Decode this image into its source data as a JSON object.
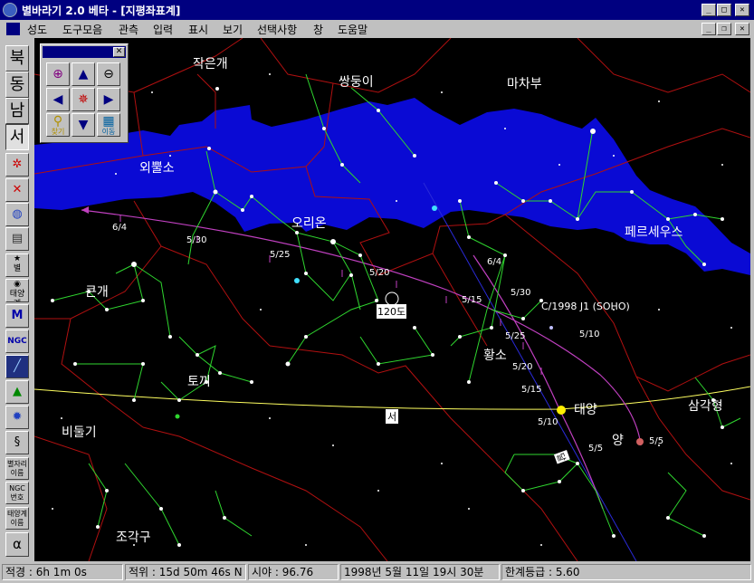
{
  "window": {
    "title": "별바라기 2.0 베타 - [지평좌표계]"
  },
  "menu": [
    "성도",
    "도구모음",
    "관측",
    "입력",
    "표시",
    "보기",
    "선택사항",
    "창",
    "도움말"
  ],
  "toolbar": {
    "directions": [
      "북",
      "동",
      "남",
      "서"
    ],
    "small_labels": [
      "별자리 이름",
      "NGC 번호",
      "태양계 이름"
    ],
    "greek": "α",
    "tools": [
      "ecliptic-grid-icon",
      "cross-icon",
      "globe-icon",
      "printer-icon",
      "star-chart-icon",
      "eye-icon",
      "messier-icon",
      "ngc-icon",
      "telescope-icon",
      "planet-icon",
      "sun-icon",
      "spiral-icon"
    ],
    "tool_labels": {
      "stars": "별",
      "solar": "태양계",
      "messier": "M",
      "ngc": "NGC"
    }
  },
  "nav_panel": {
    "find_label": "찾기",
    "move_label": "이동"
  },
  "sky": {
    "constellations": [
      "작은개",
      "쌍둥이",
      "마차부",
      "외뿔소",
      "오리온",
      "페르세우스",
      "큰개",
      "황소",
      "토끼",
      "비둘기",
      "조각구",
      "삼각형"
    ],
    "objects": {
      "sun": "태양",
      "moon": "달",
      "comet": "C/1998 J1 (SOHO)",
      "aries": "양"
    },
    "horizon_label": "서",
    "fov_label": "120도",
    "comet_dates": [
      "6/4",
      "5/30",
      "5/25",
      "5/20",
      "5/15"
    ],
    "sun_dates": [
      "6/4",
      "5/30",
      "5/25",
      "5/20",
      "5/15",
      "5/10",
      "5/5"
    ],
    "comet_side_dates": [
      "5/10",
      "5/5"
    ]
  },
  "status": {
    "ra": "적경 : 6h  1m  0s",
    "dec": "적위 : 15d 50m 46s N",
    "fov": "시야 : 96.76",
    "datetime": "1998년 5월 11일 19시 30분",
    "limit_mag": "한계등급 : 5.60"
  },
  "colors": {
    "milkyway": "#0a0ad4",
    "constellation_line": "#2fd62f",
    "boundary": "#b01010",
    "ecliptic": "#ffff60",
    "comet_path": "#c040c0",
    "horizon": "#2a2ad8",
    "titlebar": "#000080"
  }
}
